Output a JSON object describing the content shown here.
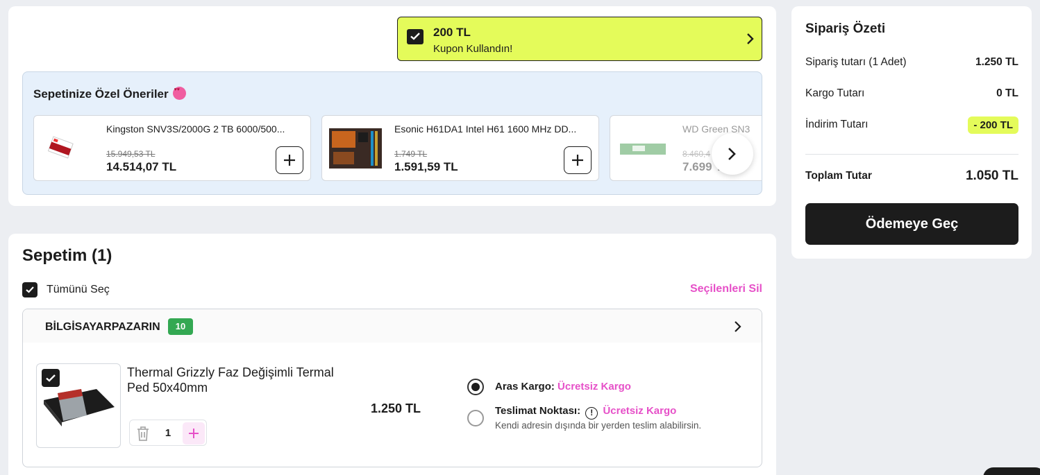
{
  "coupon": {
    "amount": "200 TL",
    "label": "Kupon Kullandın!"
  },
  "recommendations": {
    "title": "Sepetinize Özel Öneriler",
    "items": [
      {
        "name": "Kingston SNV3S/2000G 2 TB 6000/500...",
        "old_price": "15.949,53 TL",
        "price": "14.514,07 TL"
      },
      {
        "name": "Esonic H61DA1 Intel H61 1600 MHz DD...",
        "old_price": "1.749 TL",
        "price": "1.591,59 TL"
      },
      {
        "name": "WD Green SN3",
        "old_price": "8.460,4",
        "price": "7.699 TL"
      }
    ]
  },
  "cart": {
    "title": "Sepetim (1)",
    "select_all": "Tümünü Seç",
    "delete_selected": "Seçilenleri Sil",
    "seller": {
      "name": "BİLGİSAYARPAZARIN",
      "rating": "10"
    },
    "product": {
      "name": "Thermal Grizzly Faz Değişimli Termal Ped 50x40mm",
      "price": "1.250 TL",
      "quantity": "1"
    },
    "shipping": {
      "option1_label": "Aras Kargo:",
      "option1_value": "Ücretsiz Kargo",
      "option2_label": "Teslimat Noktası:",
      "option2_info": "!",
      "option2_value": "Ücretsiz Kargo",
      "option2_desc": "Kendi adresin dışında bir yerden teslim alabilirsin."
    }
  },
  "summary": {
    "title": "Sipariş Özeti",
    "order_label": "Sipariş tutarı (1 Adet)",
    "order_value": "1.250 TL",
    "shipping_label": "Kargo Tutarı",
    "shipping_value": "0 TL",
    "discount_label": "İndirim Tutarı",
    "discount_value": "- 200 TL",
    "total_label": "Toplam Tutar",
    "total_value": "1.050 TL",
    "checkout_label": "Ödemeye Geç"
  },
  "colors": {
    "accent_lime": "#e4fb5a",
    "accent_pink": "#e650c8",
    "badge_green": "#33a852",
    "dark": "#1c1c1c"
  }
}
